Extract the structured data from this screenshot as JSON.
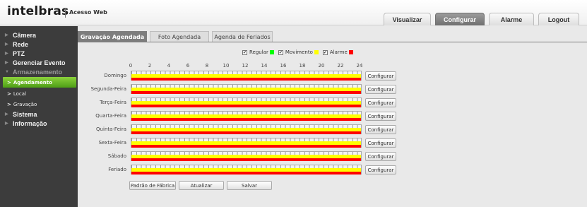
{
  "header": {
    "logo": "intelbras",
    "app_name": "Acesso Web",
    "tabs": [
      {
        "label": "Visualizar",
        "active": false
      },
      {
        "label": "Configurar",
        "active": true
      },
      {
        "label": "Alarme",
        "active": false
      },
      {
        "label": "Logout",
        "active": false
      }
    ]
  },
  "sidebar": {
    "items": [
      {
        "label": "Câmera",
        "type": "item"
      },
      {
        "label": "Rede",
        "type": "item"
      },
      {
        "label": "PTZ",
        "type": "item"
      },
      {
        "label": "Gerenciar Evento",
        "type": "item"
      },
      {
        "label": "Armazenamento",
        "type": "open"
      },
      {
        "label": "Agendamento",
        "type": "sub-active"
      },
      {
        "label": "Local",
        "type": "sub"
      },
      {
        "label": "Gravação",
        "type": "sub"
      },
      {
        "label": "Sistema",
        "type": "item"
      },
      {
        "label": "Informação",
        "type": "item"
      }
    ]
  },
  "content": {
    "tabs": [
      {
        "label": "Gravação Agendada",
        "active": true
      },
      {
        "label": "Foto Agendada",
        "active": false
      },
      {
        "label": "Agenda de Feriados",
        "active": false
      }
    ],
    "legend": [
      {
        "label": "Regular",
        "checked": true,
        "color": "#00ff00"
      },
      {
        "label": "Movimento",
        "checked": true,
        "color": "#ffff00"
      },
      {
        "label": "Alarme",
        "checked": true,
        "color": "#ff0000"
      }
    ],
    "hour_ticks": [
      "0",
      "2",
      "4",
      "6",
      "8",
      "10",
      "12",
      "14",
      "16",
      "18",
      "20",
      "22",
      "24"
    ],
    "days": [
      "Domingo",
      "Segunda-Feira",
      "Terça-Feira",
      "Quarta-Feira",
      "Quinta-Feira",
      "Sexta-Feira",
      "Sábado",
      "Feriado"
    ],
    "configure_label": "Configurar",
    "buttons": {
      "factory": "Padrão de Fábrica",
      "refresh": "Atualizar",
      "save": "Salvar"
    }
  }
}
